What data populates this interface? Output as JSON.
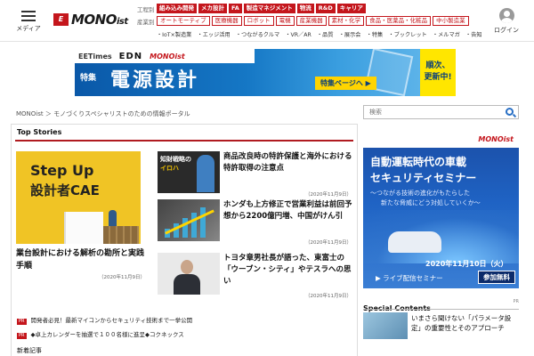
{
  "header": {
    "menu_label": "メディア",
    "logo_mark": "E",
    "logo_text": "MONO",
    "logo_suffix": "ist",
    "login_label": "ログイン",
    "nav_row1_label": "工程別",
    "nav_row1": [
      "組み込み開発",
      "メカ設計",
      "FA",
      "製造マネジメント",
      "物流",
      "R&D",
      "キャリア"
    ],
    "nav_row2_label": "産業別",
    "nav_row2": [
      "オートモーティブ",
      "医療機器",
      "ロボット",
      "電機",
      "産業機器",
      "素材・化学",
      "食品・医薬品・化粧品",
      "中小製造業"
    ],
    "nav_row3": "・IoT×製造業　・エッジ活用　・つながるクルマ　・VR／AR　・品質　・展示会　・特集　・ブックレット　・メルマガ　・告知"
  },
  "banner": {
    "logo1": "EETimes",
    "logo2": "EDN",
    "logo3": "MONOist",
    "feature": "特集",
    "title": "電源設計",
    "cta": "特集ページへ ▶",
    "note_line1": "順次、",
    "note_line2": "更新中!"
  },
  "breadcrumb": "MONOist ＞ モノづくりスペシャリストのための情報ポータル",
  "search": {
    "placeholder": "検索"
  },
  "top_stories": {
    "title": "Top Stories",
    "feature": {
      "image_text1": "Step Up",
      "image_text2": "設計者CAE",
      "title": "業台設計における解析の勘所と実践手順",
      "date": "（2020年11月9日）"
    },
    "stories": [
      {
        "thumb_text1": "知財戦略の",
        "thumb_text2": "イロハ",
        "title": "商品改良時の特許保護と海外における特許取得の注意点",
        "date": "（2020年11月9日）"
      },
      {
        "title": "ホンダも上方修正で営業利益は前回予想から2200億円増、中国がけん引",
        "date": "（2020年11月9日）"
      },
      {
        "title": "トヨタ章男社長が語った、東富士の「ウーブン・シティ」やテスラへの思い",
        "date": "（2020年11月9日）"
      }
    ],
    "news": [
      {
        "tag": "PR",
        "text": "開発者必見！最新マイコンからセキュリティ技術まで一挙公開"
      },
      {
        "tag": "PR",
        "text": "◆卓上カレンダーを抽選で１００名様に進呈◆コクネックス"
      }
    ],
    "newest_label": "新着記事"
  },
  "ad_right": {
    "brand": "MONOist",
    "headline1": "自動運転時代の車載",
    "headline2": "セキュリティセミナー",
    "sub1": "〜つながる技術の進化がもたらした",
    "sub2": "新たな脅威にどう対処していくか〜",
    "date": "2020年11月10日（火）",
    "live": "▶ ライブ配信セミナー",
    "join": "参加無料"
  },
  "special": {
    "title": "Special Contents",
    "pr": "PR",
    "item_title": "いまさら聞けない「パラメータ設定」の重要性とそのアプローチ"
  }
}
